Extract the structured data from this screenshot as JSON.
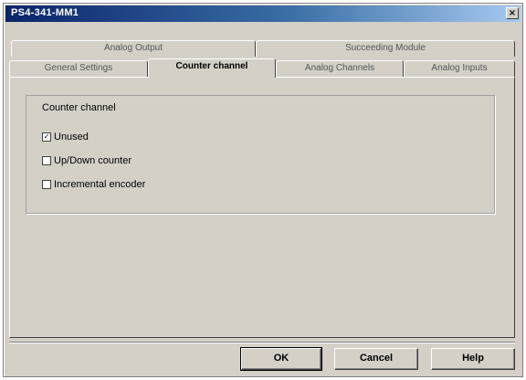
{
  "window": {
    "title": "PS4-341-MM1",
    "close_glyph": "×"
  },
  "tabs": {
    "row_back": [
      {
        "label": "Analog Output"
      },
      {
        "label": "Succeeding Module"
      }
    ],
    "row_front": [
      {
        "label": "General Settings"
      },
      {
        "label": "Counter channel",
        "active": true
      },
      {
        "label": "Analog Channels"
      },
      {
        "label": "Analog Inputs"
      }
    ]
  },
  "counter_group": {
    "title": "Counter channel",
    "options": [
      {
        "label": "Unused",
        "checked": true
      },
      {
        "label": "Up/Down counter",
        "checked": false
      },
      {
        "label": "Incremental encoder",
        "checked": false
      }
    ]
  },
  "buttons": {
    "ok": "OK",
    "cancel": "Cancel",
    "help": "Help"
  },
  "icons": {
    "close": "close-icon",
    "checkbox_mark": "✓"
  },
  "colors": {
    "titlebar_start": "#0a246a",
    "titlebar_end": "#a6caf0",
    "face": "#d4d0c8"
  }
}
